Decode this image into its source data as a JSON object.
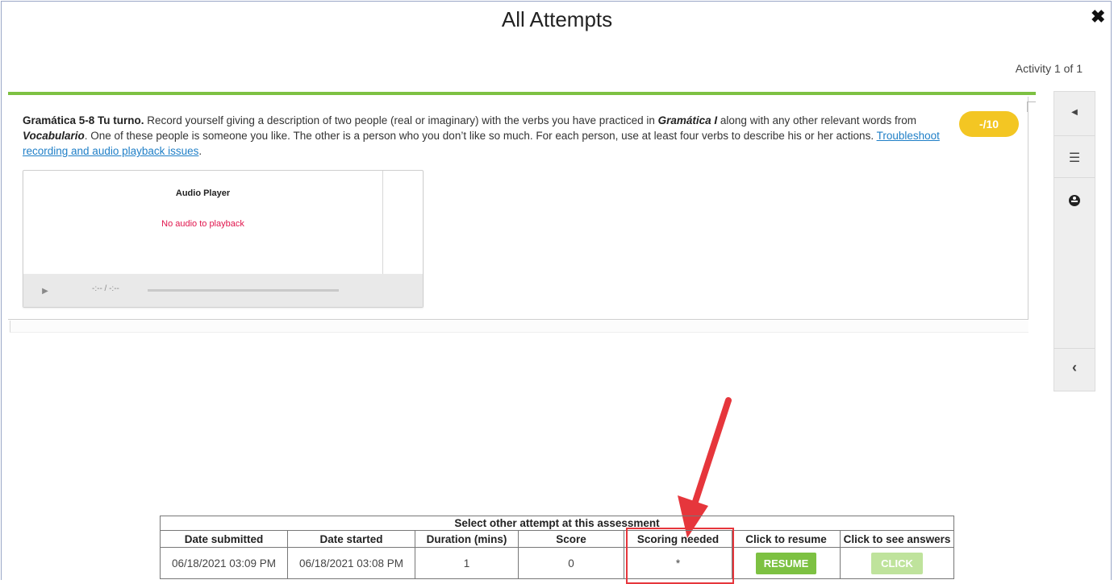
{
  "window": {
    "title": "All Attempts",
    "close_icon": "close-icon",
    "activity_count": "Activity 1 of 1"
  },
  "question": {
    "heading": "Gramática 5-8 Tu turno.",
    "text_1": " Record yourself giving a description of two people (real or imaginary) with the verbs you have practiced in ",
    "emph_1": "Gramática I",
    "text_2": " along with any other relevant words from ",
    "emph_2": "Vocabulario",
    "text_3": ". One of these people is someone you like. The other is a person who you don’t like so much. For each person, use at least four verbs to describe his or her actions. ",
    "link": "Troubleshoot recording and audio playback issues",
    "text_4": ".",
    "score_badge": "-/10"
  },
  "audio_player": {
    "title": "Audio Player",
    "message": "No audio to playback",
    "play_icon": "play-icon",
    "time": "-:-- / -:--"
  },
  "right_rail": {
    "prev_icon": "triangle-left-icon",
    "menu_icon": "menu-icon",
    "accessibility_icon": "accessibility-icon",
    "collapse_icon": "chevron-left-icon"
  },
  "attempts_table": {
    "caption": "Select other attempt at this assessment",
    "headers": [
      "Date submitted",
      "Date started",
      "Duration (mins)",
      "Score",
      "Scoring needed",
      "Click to resume",
      "Click to see answers"
    ],
    "rows": [
      {
        "date_submitted": "06/18/2021 03:09 PM",
        "date_started": "06/18/2021 03:08 PM",
        "duration": "1",
        "score": "0",
        "scoring_needed": "*",
        "resume_label": "RESUME",
        "answers_label": "CLICK"
      }
    ]
  },
  "annotation": {
    "arrow_color": "#e6363c",
    "highlight_color": "#e6363c"
  }
}
